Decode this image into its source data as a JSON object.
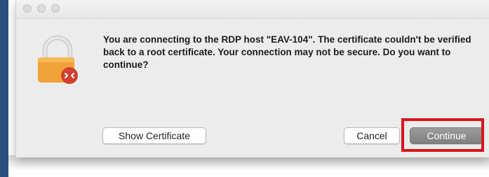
{
  "dialog": {
    "message": "You are connecting to the RDP host \"EAV-104\". The certificate couldn't be verified back to a root certificate. Your connection may not be secure. Do you want to continue?",
    "icon": "lock-icon",
    "buttons": {
      "show_certificate": "Show Certificate",
      "cancel": "Cancel",
      "continue": "Continue"
    },
    "colors": {
      "lock_body": "#f0a23a",
      "lock_shackle": "#d8d8d8",
      "badge": "#d2402f",
      "highlight": "#d9151b"
    }
  }
}
